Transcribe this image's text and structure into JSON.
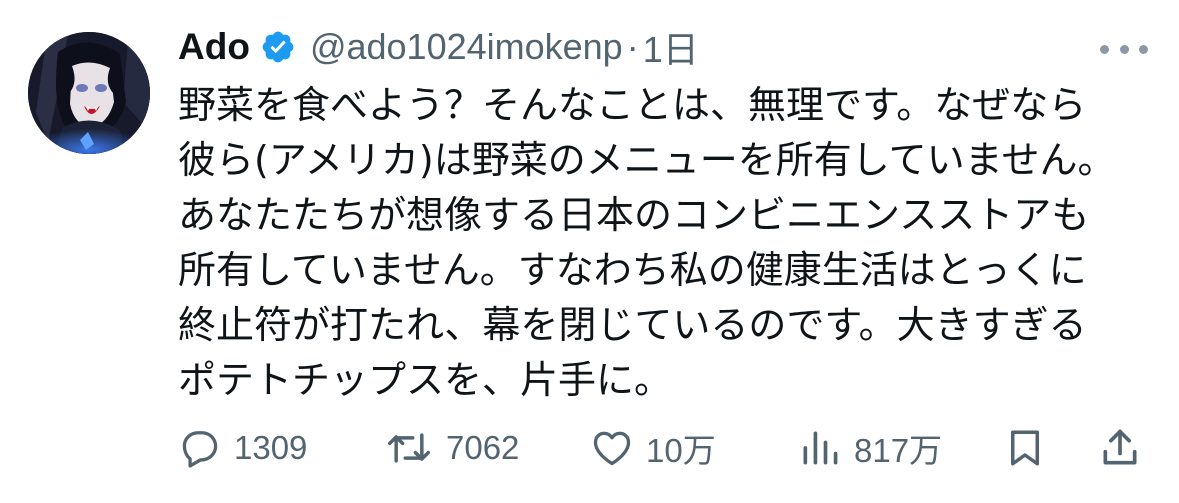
{
  "post": {
    "author": {
      "display_name": "Ado",
      "handle": "@ado1024imokenp",
      "separator": "·",
      "time": "1日"
    },
    "text_lines": [
      "野菜を食べよう？そんなことは、無理です。なぜなら",
      "彼ら(アメリカ)は野菜のメニューを所有していません。",
      "あなたたちが想像する日本のコンビニエンスストアも",
      "所有していません。すなわち私の健康生活はとっくに",
      "終止符が打たれ、幕を閉じているのです。大きすぎる",
      "ポテトチップスを、片手に。"
    ],
    "metrics": {
      "replies": "1309",
      "reposts": "7062",
      "likes": "10万",
      "views": "817万"
    }
  },
  "icons": {
    "verified": "verified-badge-icon",
    "more": "more-horizontal-icon",
    "reply": "reply-icon",
    "repost": "repost-icon",
    "like": "heart-icon",
    "views": "views-chart-icon",
    "bookmark": "bookmark-icon",
    "share": "share-icon"
  },
  "colors": {
    "text": "#0f1419",
    "secondary": "#536471",
    "verified": "#1d9bf0"
  }
}
